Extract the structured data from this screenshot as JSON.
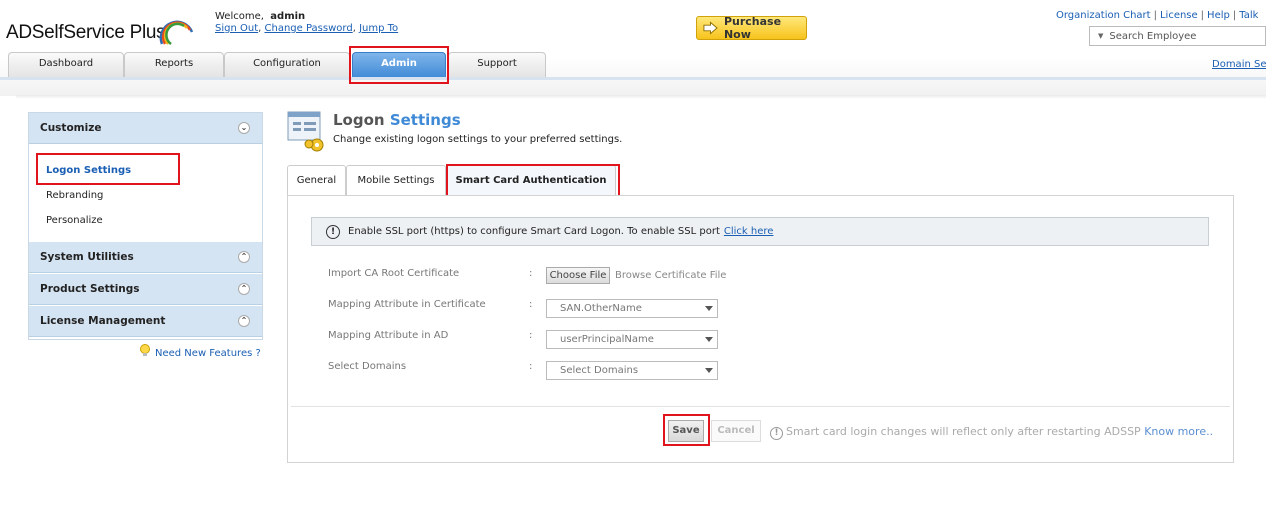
{
  "app": {
    "name": "ADSelfService Plus",
    "colors": {
      "accent": "#3f8ad6",
      "highlight": "#e0141c",
      "link": "#1a5fb4"
    }
  },
  "header": {
    "welcome_prefix": "Welcome,",
    "user": "admin",
    "links": [
      "Sign Out",
      "Change Password",
      "Jump To"
    ],
    "purchase_label": "Purchase Now",
    "top_links": [
      "Organization Chart",
      "License",
      "Help",
      "Talk"
    ],
    "search_placeholder": "Search Employee",
    "domain_link": "Domain Se"
  },
  "tabs": [
    "Dashboard",
    "Reports",
    "Configuration",
    "Admin",
    "Support"
  ],
  "sidebar": {
    "sections": [
      {
        "title": "Customize",
        "items": [
          "Logon Settings",
          "Rebranding",
          "Personalize"
        ]
      },
      {
        "title": "System Utilities"
      },
      {
        "title": "Product Settings"
      },
      {
        "title": "License Management"
      }
    ],
    "need_features": "Need New Features ?"
  },
  "page": {
    "title_a": "Logon",
    "title_b": "Settings",
    "subtitle": "Change existing logon settings to your preferred settings.",
    "subtabs": [
      "General",
      "Mobile Settings",
      "Smart Card Authentication"
    ]
  },
  "panel": {
    "info_text": "Enable SSL port (https) to configure Smart Card Logon. To enable SSL port",
    "info_link": "Click here",
    "rows": [
      {
        "label": "Import CA Root Certificate",
        "button": "Choose File",
        "hint": "Browse Certificate File"
      },
      {
        "label": "Mapping Attribute in Certificate",
        "value": "SAN.OtherName"
      },
      {
        "label": "Mapping Attribute in AD",
        "value": "userPrincipalName"
      },
      {
        "label": "Select Domains",
        "value": "Select Domains"
      }
    ],
    "colon": ":",
    "save_label": "Save",
    "cancel_label": "Cancel",
    "footnote": "Smart card login changes will reflect only after restarting ADSSP",
    "footnote_link": "Know more.."
  }
}
